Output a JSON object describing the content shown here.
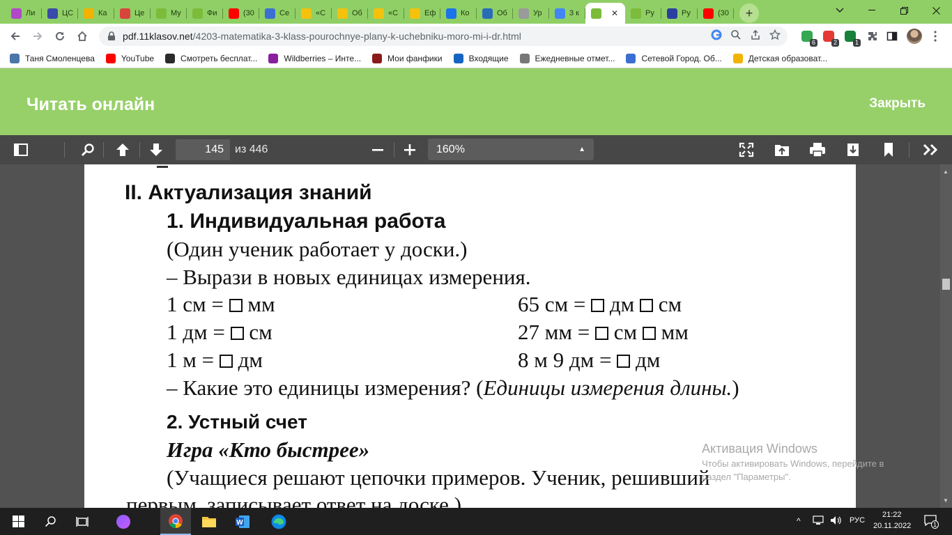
{
  "browser": {
    "tabs": [
      {
        "label": "Ли",
        "icon": "flower-icon",
        "color": "#b048c8"
      },
      {
        "label": "ЦС",
        "icon": "cube-icon",
        "color": "#3a4aa8"
      },
      {
        "label": "Ка",
        "icon": "sun-icon",
        "color": "#f2b300"
      },
      {
        "label": "Це",
        "icon": "scissors-icon",
        "color": "#d8453a"
      },
      {
        "label": "Му",
        "icon": "book-icon",
        "color": "#7cbc3a"
      },
      {
        "label": "Фи",
        "icon": "book-icon",
        "color": "#7cbc3a"
      },
      {
        "label": "(30",
        "icon": "youtube-icon",
        "color": "#ff0000"
      },
      {
        "label": "Се",
        "icon": "grid-icon",
        "color": "#3c6fd2"
      },
      {
        "label": "«С",
        "icon": "info-icon",
        "color": "#f4c20d"
      },
      {
        "label": "Об",
        "icon": "info-icon",
        "color": "#f4c20d"
      },
      {
        "label": "«С",
        "icon": "info-icon",
        "color": "#f4c20d"
      },
      {
        "label": "Еф",
        "icon": "info-icon",
        "color": "#f4c20d"
      },
      {
        "label": "Ко",
        "icon": "check-icon",
        "color": "#1a73e8"
      },
      {
        "label": "Об",
        "icon": "book-open-icon",
        "color": "#2a6bb8"
      },
      {
        "label": "Ур",
        "icon": "pen-icon",
        "color": "#9a9a9a"
      },
      {
        "label": "3 к",
        "icon": "google-icon",
        "color": "#4285f4"
      },
      {
        "label": "",
        "icon": "book-icon",
        "color": "#7cbc3a",
        "active": true
      },
      {
        "label": "Ру",
        "icon": "book-icon",
        "color": "#7cbc3a"
      },
      {
        "label": "Ру",
        "icon": "shield-icon",
        "color": "#2b3fa0"
      },
      {
        "label": "(30",
        "icon": "youtube-icon",
        "color": "#ff0000"
      }
    ],
    "url_domain": "pdf.11klasov.net",
    "url_path": "/4203-matematika-3-klass-pourochnye-plany-k-uchebniku-moro-mi-i-dr.html",
    "extensions": [
      {
        "icon": "extension-green-icon",
        "badge": "6"
      },
      {
        "icon": "adblock-icon",
        "badge": "2"
      },
      {
        "icon": "extension-shield-icon",
        "badge": "1"
      }
    ],
    "bookmarks": [
      {
        "label": "Таня Смоленцева",
        "icon": "vk-icon",
        "color": "#4a76a8"
      },
      {
        "label": "YouTube",
        "icon": "youtube-icon",
        "color": "#ff0000"
      },
      {
        "label": "Смотреть бесплат...",
        "icon": "d-icon",
        "color": "#2b2b2b"
      },
      {
        "label": "Wildberries – Инте...",
        "icon": "w-icon",
        "color": "#8a1f9e"
      },
      {
        "label": "Мои фанфики",
        "icon": "quill-icon",
        "color": "#8b1a1a"
      },
      {
        "label": "Входящие",
        "icon": "mail-icon",
        "color": "#1565c0"
      },
      {
        "label": "Ежедневные отмет...",
        "icon": "calendar-icon",
        "color": "#777777"
      },
      {
        "label": "Сетевой Город. Об...",
        "icon": "grid-icon",
        "color": "#3c6fd2"
      },
      {
        "label": "Детская образоват...",
        "icon": "sun-icon",
        "color": "#f2b300"
      }
    ]
  },
  "reader": {
    "title": "Читать онлайн",
    "close_label": "Закрыть"
  },
  "pdf": {
    "current_page": "145",
    "total_label": "из 446",
    "zoom": "160%"
  },
  "content": {
    "section": "II. Актуализация знаний",
    "sub1": "1. Индивидуальная работа",
    "note1": "(Один ученик работает у доски.)",
    "task1": "–  Вырази в новых единицах измерения.",
    "eq": [
      {
        "a": "1 см = ",
        "b": " мм",
        "c": "",
        "d": ""
      },
      {
        "a": "1 дм = ",
        "b": " см",
        "c": "",
        "d": ""
      },
      {
        "a": "1 м = ",
        "b": " дм",
        "c": "",
        "d": ""
      }
    ],
    "eq_right": [
      {
        "a": "65 см = ",
        "b": " дм ",
        "c": " см"
      },
      {
        "a": "27 мм = ",
        "b": " см ",
        "c": " мм"
      },
      {
        "a": "8 м 9 дм = ",
        "b": " дм",
        "c": ""
      }
    ],
    "question": "–  Какие это единицы измерения? (",
    "answer": "Единицы измерения длины.",
    "answer_close": ")",
    "sub2": "2. Устный счет",
    "game": "Игра «Кто быстрее»",
    "note2": "(Учащиеся решают цепочки примеров. Ученик, решивший",
    "note2b": "первым, записывает ответ на доске.)"
  },
  "watermark": {
    "title": "Активация Windows",
    "text": "Чтобы активировать Windows, перейдите в",
    "text2": "раздел \"Параметры\"."
  },
  "taskbar": {
    "lang": "РУС",
    "time": "21:22",
    "date": "20.11.2022",
    "notifications": "1"
  }
}
